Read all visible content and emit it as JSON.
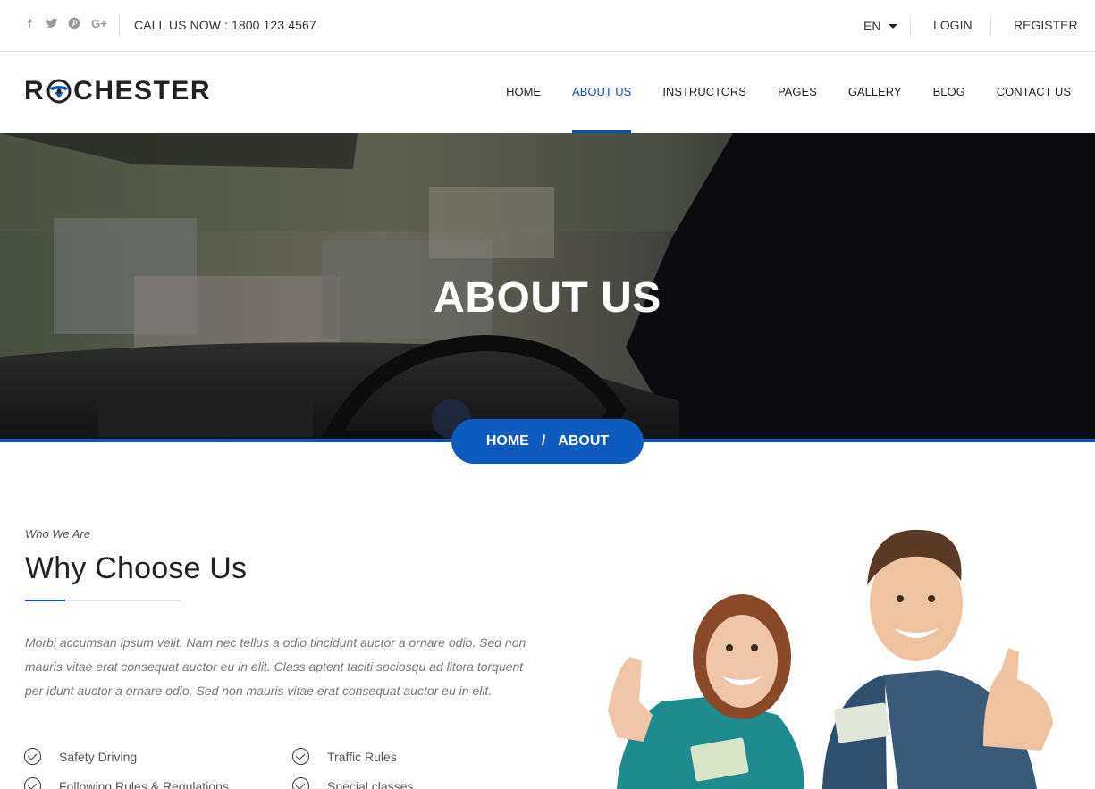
{
  "topbar": {
    "social_icons": [
      "facebook-icon",
      "twitter-icon",
      "pinterest-icon",
      "google-plus-icon"
    ],
    "call_text": "CALL US NOW : 1800 123 4567",
    "language": "EN",
    "login": "LOGIN",
    "register": "REGISTER"
  },
  "brand": {
    "logo_left": "R",
    "logo_right": "CHESTER"
  },
  "nav": {
    "items": [
      "HOME",
      "ABOUT US",
      "INSTRUCTORS",
      "PAGES",
      "GALLERY",
      "BLOG",
      "CONTACT US"
    ],
    "active": "ABOUT US"
  },
  "hero": {
    "title": "ABOUT US",
    "breadcrumb": {
      "home": "HOME",
      "separator": "/",
      "current": "ABOUT"
    }
  },
  "about": {
    "eyebrow": "Who We Are",
    "heading": "Why Choose Us",
    "paragraph": "Morbi accumsan ipsum velit. Nam nec tellus a odio tincidunt auctor a ornare odio. Sed non mauris vitae erat consequat auctor eu in elit. Class aptent taciti sociosqu ad litora torquent per idunt auctor a ornare odio. Sed non mauris vitae erat consequat auctor eu in elit.",
    "features": [
      "Safety Driving",
      "Traffic Rules",
      "Following Rules & Regulations",
      "Special classes"
    ]
  },
  "colors": {
    "accent": "#0e5bc0",
    "text": "#222222",
    "muted": "#777777"
  }
}
